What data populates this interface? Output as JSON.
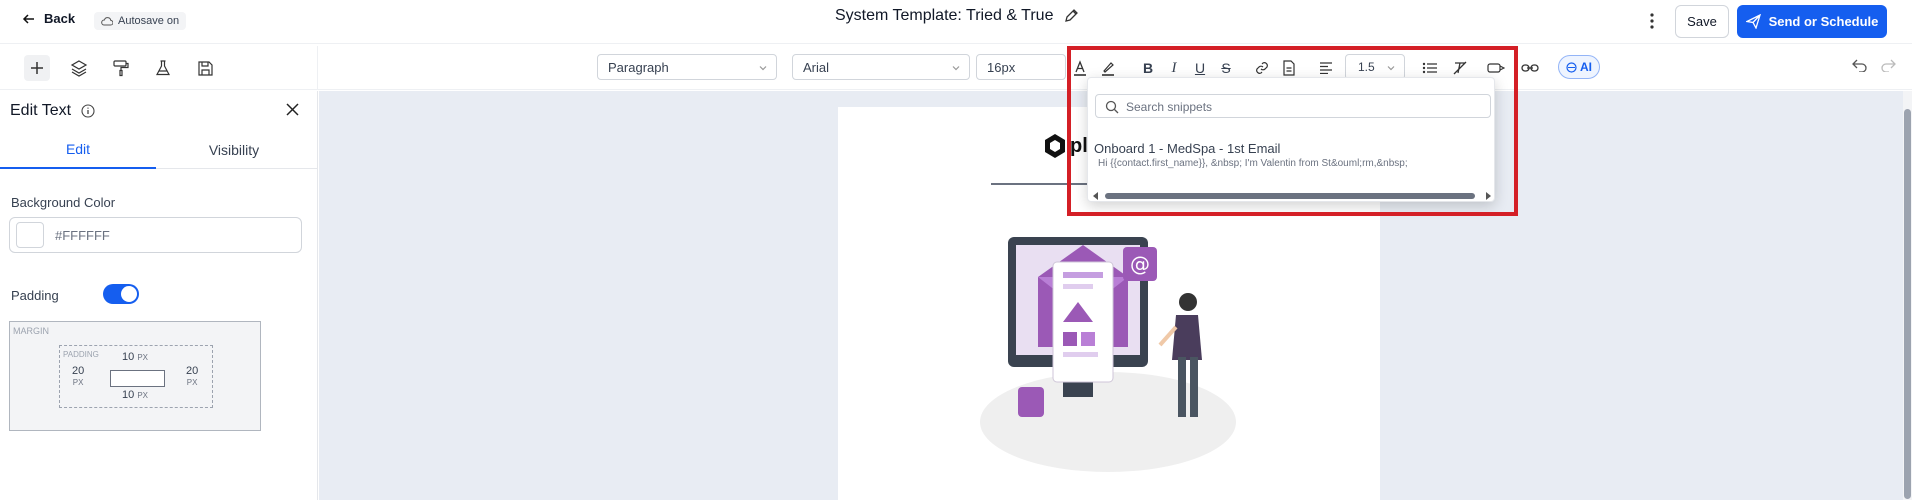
{
  "header": {
    "back_label": "Back",
    "autosave_label": "Autosave on",
    "title": "System Template: Tried & True",
    "save_label": "Save",
    "send_label": "Send or Schedule"
  },
  "toolbar": {
    "block_format": "Paragraph",
    "font_family": "Arial",
    "font_size": "16px",
    "line_height": "1.5",
    "ai_label": "AI"
  },
  "left_panel": {
    "title": "Edit Text",
    "tabs": [
      "Edit",
      "Visibility"
    ],
    "active_tab": "Edit",
    "background_color_label": "Background Color",
    "background_color_value": "#FFFFFF",
    "padding_label": "Padding",
    "padding_enabled": true,
    "margin_label": "MARGIN",
    "padding_box_label": "PADDING",
    "padding_values": {
      "top": "10",
      "right": "20",
      "bottom": "10",
      "left": "20",
      "unit": "PX"
    }
  },
  "canvas": {
    "logo_text": "pl"
  },
  "snippets_popup": {
    "search_placeholder": "Search snippets",
    "items": [
      {
        "title": "Onboard 1 - MedSpa - 1st Email",
        "preview": "Hi {{contact.first_name}}, &nbsp; I'm Valentin from St&ouml;rm,&nbsp;"
      }
    ]
  },
  "colors": {
    "accent": "#155eef",
    "highlight": "#d41f26",
    "canvas_bg": "#e8ecf3"
  }
}
